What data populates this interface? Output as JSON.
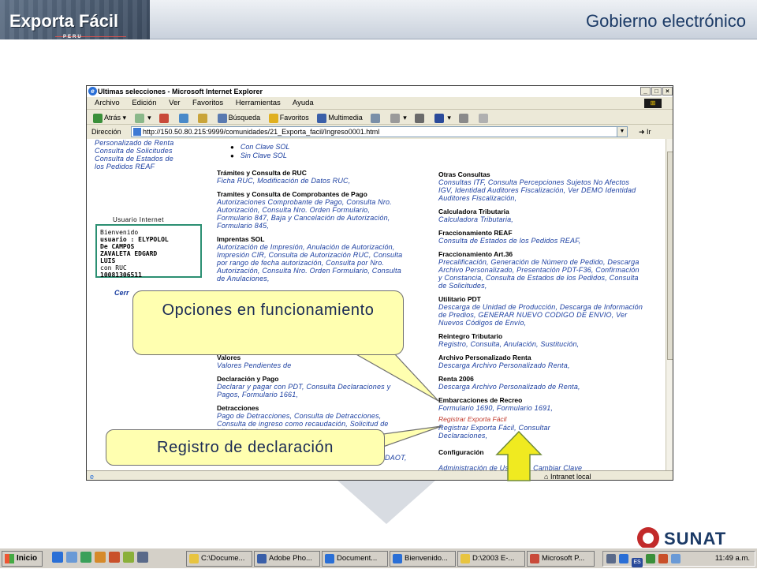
{
  "header": {
    "logo_title": "Exporta Fácil",
    "logo_sub": "PERU",
    "title": "Gobierno electrónico"
  },
  "browser": {
    "title": "Ultimas selecciones - Microsoft Internet Explorer",
    "menu": [
      "Archivo",
      "Edición",
      "Ver",
      "Favoritos",
      "Herramientas",
      "Ayuda"
    ],
    "toolbar": {
      "back": "Atrás",
      "search": "Búsqueda",
      "favorites": "Favoritos",
      "media": "Multimedia"
    },
    "address_label": "Dirección",
    "address": "http://150.50.80.215:9999/comunidades/21_Exporta_facil/Ingreso0001.html",
    "go": "Ir",
    "status_zone": "Intranet local"
  },
  "content": {
    "left_links": [
      "Personalizado de Renta",
      "Consulta de Solicitudes",
      "Consulta de Estados de",
      "los Pedidos REAF"
    ],
    "bullets": [
      "Con Clave SOL",
      "Sin Clave SOL"
    ],
    "user_label": "Usuario Internet",
    "user_lines": [
      "Bienvenido",
      "usuario : ELYPOLOL",
      "De CAMPOS",
      "ZAVALETA EDGARD",
      "LUIS",
      "con RUC",
      "10081306511"
    ],
    "cerrar": "Cerr",
    "mid": [
      {
        "title": "Trámites y Consulta de RUC",
        "links": "Ficha RUC, Modificación de Datos RUC,"
      },
      {
        "title": "Tramites y Consulta de Comprobantes de Pago",
        "links": "Autorizaciones Comprobante de Pago, Consulta Nro. Autorización, Consulta Nro. Orden Formulario, Formulario 847, Baja y Cancelación de Autorización, Formulario 845,"
      },
      {
        "title": "Imprentas SOL",
        "links": "Autorización de Impresión, Anulación de Autorización, Impresión CIR, Consulta de Autorización RUC, Consulta por rango de fecha autorización, Consulta por Nro. Autorización, Consulta Nro. Orden Formulario, Consulta de Anulaciones,"
      }
    ],
    "mid_low": [
      {
        "title": "Valores",
        "links": "Valores Pendientes de"
      },
      {
        "title": "Declaración y Pago",
        "links": "Declarar y pagar con PDT, Consulta Declaraciones y Pagos, Formulario 1661,"
      },
      {
        "title": "Detracciones",
        "links": "Pago de Detracciones, Consulta de Detracciones, Consulta de ingreso como recaudación, Solicitud de Liberación de"
      }
    ],
    "mid_frag": "DAOT,",
    "right": [
      {
        "title": "Otras Consultas",
        "links": "Consultas ITF, Consulta Percepciones Sujetos No Afectos IGV, Identidad Auditores Fiscalización, Ver DEMO Identidad Auditores Fiscalización,"
      },
      {
        "title": "Calculadora Tributaria",
        "links": "Calculadora Tributaria,"
      },
      {
        "title": "Fraccionamiento REAF",
        "links": "Consulta de Estados de los Pedidos REAF,"
      },
      {
        "title": "Fraccionamiento Art.36",
        "links": "Precalificación, Generación de Número de Pedido, Descarga Archivo Personalizado, Presentación PDT-F36, Confirmación y Constancia, Consulta de Estados de los Pedidos, Consulta de Solicitudes,"
      },
      {
        "title": "Utilitario PDT",
        "links": "Descarga de Unidad de Producción, Descarga de Información de Predios, GENERAR NUEVO CODIGO DE ENVIO, Ver Nuevos Códigos de Envío,"
      },
      {
        "title": "Reintegro Tributario",
        "links": "Registro, Consulta, Anulación, Sustitución,"
      },
      {
        "title": "Archivo Personalizado Renta",
        "links": "Descarga Archivo Personalizado Renta,"
      },
      {
        "title": "Renta 2006",
        "links": "Descarga Archivo Personalizado de Renta,"
      },
      {
        "title": "Embarcaciones de Recreo",
        "links": "Formulario 1690, Formulario 1691,"
      }
    ],
    "registrar_red": "Registrar Exporta Fácil",
    "registrar_links": "Registrar Exporta Fácil, Consultar Declaraciones,",
    "config_title": "Configuración",
    "config_links": "Administración de Usuarios, Cambiar Clave"
  },
  "callouts": {
    "c1": "Opciones en funcionamiento",
    "c2": "Registro de declaración"
  },
  "sunat": "SUNAT",
  "taskbar": {
    "start": "Inicio",
    "tasks": [
      "C:\\Docume...",
      "Adobe Pho...",
      "Document...",
      "Bienvenido...",
      "D:\\2003 E-...",
      "Microsoft P..."
    ],
    "lang": "ES",
    "clock": "11:49 a.m."
  },
  "colors": {
    "link": "#1a3ea0",
    "callout_fill": "#ffffb0",
    "arrow": "#f0ea20",
    "sunat_red": "#c22a2a",
    "sunat_blue": "#1b3a66"
  }
}
